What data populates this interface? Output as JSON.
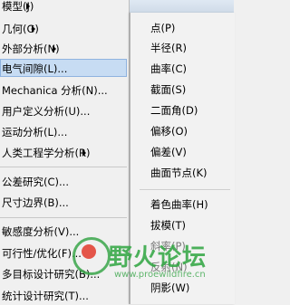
{
  "left_menu": {
    "items": [
      {
        "label": "模型(J)",
        "has_submenu": true
      },
      {
        "label": "几何(G)",
        "has_submenu": true
      },
      {
        "label": "外部分析(N)",
        "has_submenu": true
      },
      {
        "label": "电气间隙(L)...",
        "has_submenu": false
      },
      {
        "label": "Mechanica 分析(N)...",
        "has_submenu": false
      },
      {
        "label": "用户定义分析(U)...",
        "has_submenu": false
      },
      {
        "label": "运动分析(L)...",
        "has_submenu": false
      },
      {
        "label": "人类工程学分析(R)",
        "has_submenu": true
      },
      {
        "label": "公差研究(C)...",
        "has_submenu": false
      },
      {
        "label": "尺寸边界(B)...",
        "has_submenu": false
      },
      {
        "label": "敏感度分析(V)...",
        "has_submenu": false
      },
      {
        "label": "可行性/优化(F)...",
        "has_submenu": false
      },
      {
        "label": "多目标设计研究(B)...",
        "has_submenu": false
      },
      {
        "label": "统计设计研究(T)...",
        "has_submenu": false
      }
    ]
  },
  "submenu": {
    "items": [
      {
        "label": "点(P)"
      },
      {
        "label": "半径(R)"
      },
      {
        "label": "曲率(C)"
      },
      {
        "label": "截面(S)"
      },
      {
        "label": "二面角(D)"
      },
      {
        "label": "偏移(O)"
      },
      {
        "label": "偏差(V)"
      },
      {
        "label": "曲面节点(K)"
      },
      {
        "label": "着色曲率(H)"
      },
      {
        "label": "拔模(T)"
      },
      {
        "label": "斜率(P)"
      },
      {
        "label": "反射(N)"
      },
      {
        "label": "阴影(W)"
      }
    ]
  },
  "watermark": {
    "text": "野火论坛",
    "url": "www.proewildfire.cn"
  }
}
